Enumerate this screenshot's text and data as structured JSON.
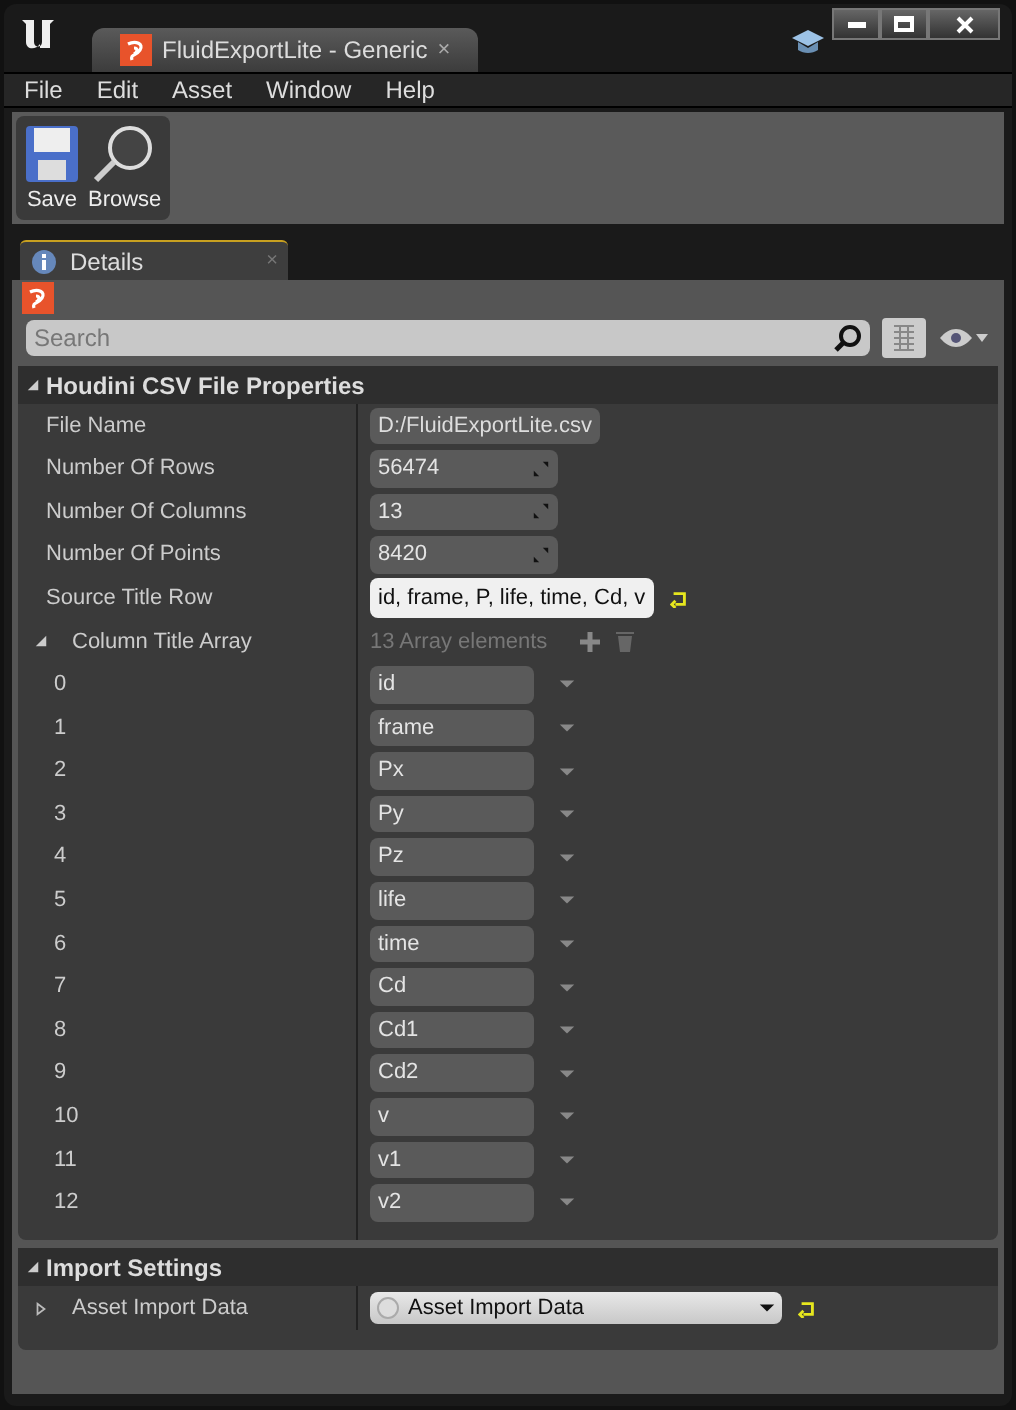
{
  "window": {
    "tab_title": "FluidExportLite - Generic",
    "tab_close": "×"
  },
  "menu": [
    "File",
    "Edit",
    "Asset",
    "Window",
    "Help"
  ],
  "toolbar": [
    "Save",
    "Browse"
  ],
  "panel_tab": {
    "label": "Details",
    "close": "×",
    "selected": true
  },
  "search": {
    "placeholder": "Search"
  },
  "sections": [
    {
      "title": "Houdini CSV File Properties",
      "expanded": true,
      "rows": [
        {
          "kind": "text",
          "label": "File Name",
          "value": "D:/FluidExportLite.csv"
        },
        {
          "kind": "number",
          "label": "Number Of Rows",
          "value": "56474"
        },
        {
          "kind": "number",
          "label": "Number Of Columns",
          "value": "13"
        },
        {
          "kind": "number",
          "label": "Number Of Points",
          "value": "8420"
        },
        {
          "kind": "edit",
          "label": "Source Title Row",
          "value": "id, frame, P, life, time, Cd, v"
        },
        {
          "kind": "array",
          "label": "Column Title Array",
          "value": "13 Array elements",
          "expanded": true,
          "items": [
            {
              "index": "0",
              "value": "id"
            },
            {
              "index": "1",
              "value": "frame"
            },
            {
              "index": "2",
              "value": "Px"
            },
            {
              "index": "3",
              "value": "Py"
            },
            {
              "index": "4",
              "value": "Pz"
            },
            {
              "index": "5",
              "value": "life"
            },
            {
              "index": "6",
              "value": "time"
            },
            {
              "index": "7",
              "value": "Cd"
            },
            {
              "index": "8",
              "value": "Cd1"
            },
            {
              "index": "9",
              "value": "Cd2"
            },
            {
              "index": "10",
              "value": "v"
            },
            {
              "index": "11",
              "value": "v1"
            },
            {
              "index": "12",
              "value": "v2"
            }
          ]
        }
      ]
    },
    {
      "title": "Import Settings",
      "expanded": true,
      "rows": [
        {
          "kind": "combo",
          "label": "Asset Import Data",
          "value": "Asset Import Data",
          "expanded": false
        }
      ]
    }
  ]
}
